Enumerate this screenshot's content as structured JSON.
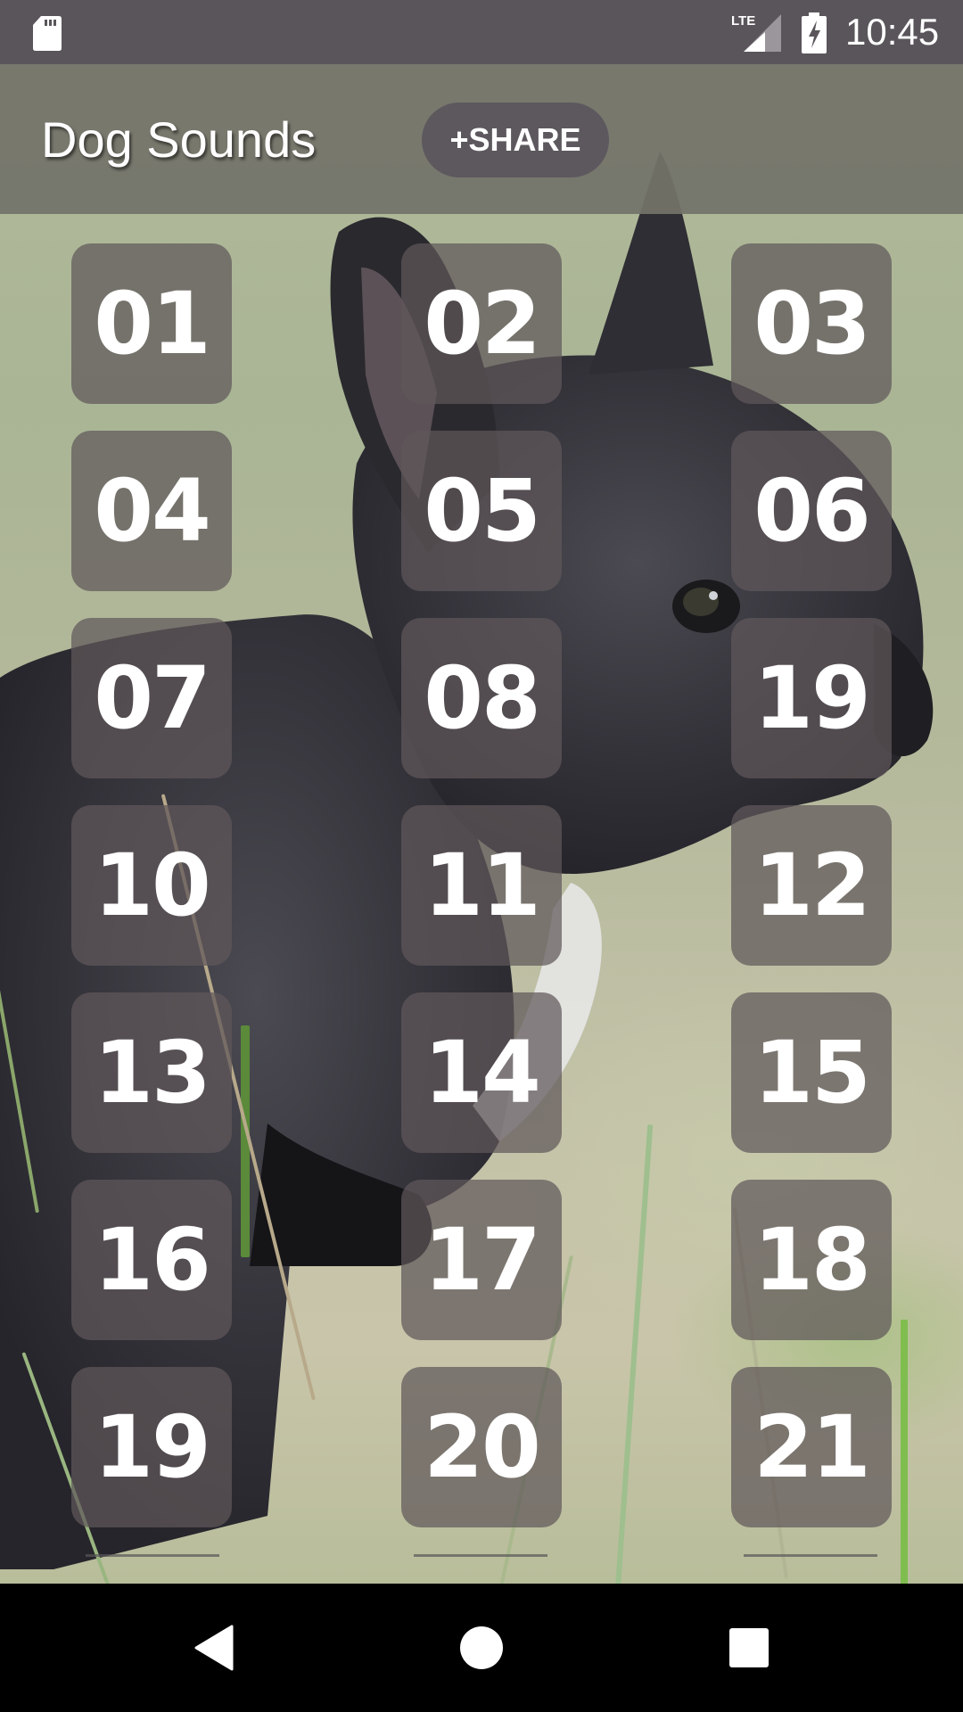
{
  "status_bar": {
    "time": "10:45",
    "network_label": "LTE",
    "icons": [
      "sd-card-icon",
      "lte-signal-icon",
      "battery-charging-icon"
    ]
  },
  "header": {
    "title": "Dog Sounds",
    "share_label": "+SHARE"
  },
  "sound_buttons": [
    {
      "label": "01"
    },
    {
      "label": "02"
    },
    {
      "label": "03"
    },
    {
      "label": "04"
    },
    {
      "label": "05"
    },
    {
      "label": "06"
    },
    {
      "label": "07"
    },
    {
      "label": "08"
    },
    {
      "label": "19"
    },
    {
      "label": "10"
    },
    {
      "label": "11"
    },
    {
      "label": "12"
    },
    {
      "label": "13"
    },
    {
      "label": "14"
    },
    {
      "label": "15"
    },
    {
      "label": "16"
    },
    {
      "label": "17"
    },
    {
      "label": "18"
    },
    {
      "label": "19"
    },
    {
      "label": "20"
    },
    {
      "label": "21"
    }
  ],
  "nav_bar": {
    "buttons": [
      "back-icon",
      "home-icon",
      "recents-icon"
    ]
  },
  "colors": {
    "status_bar": "#5a555b",
    "share_button": "#5d585e",
    "sound_button": "#5f585a",
    "nav_bar": "#000000"
  }
}
